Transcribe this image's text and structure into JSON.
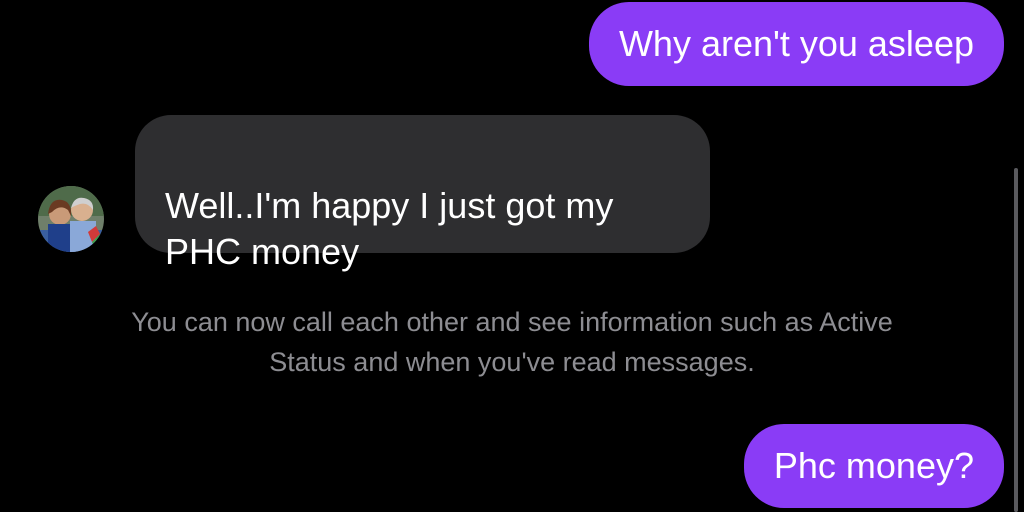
{
  "messages": [
    {
      "id": "msg1",
      "direction": "sent",
      "text": "Why aren't you asleep"
    },
    {
      "id": "msg2",
      "direction": "received",
      "text": "Well..I'm happy I just got my\nPHC money"
    },
    {
      "id": "msg3",
      "direction": "sent",
      "text": "Phc money?"
    }
  ],
  "system_note": "You can now call each other and see information such as Active\nStatus and when you've read messages.",
  "contact": {
    "avatar": "contact-avatar-photo"
  },
  "colors": {
    "background": "#000000",
    "sent_bubble": "#8a3cf6",
    "received_bubble": "#2e2e30",
    "system_text": "#8d8d92"
  }
}
